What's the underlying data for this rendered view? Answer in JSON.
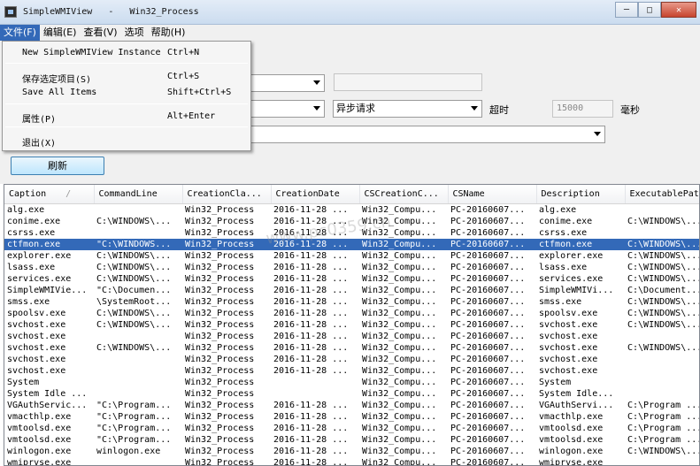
{
  "window": {
    "title": "SimpleWMIView   -   Win32_Process",
    "controls": [
      "─",
      "□",
      "✕"
    ]
  },
  "menubar": [
    {
      "label": "文件(F)",
      "active": true
    },
    {
      "label": "编辑(E)",
      "active": false
    },
    {
      "label": "查看(V)",
      "active": false
    },
    {
      "label": "选项",
      "active": false
    },
    {
      "label": "帮助(H)",
      "active": false
    }
  ],
  "file_menu": [
    {
      "label": "New SimpleWMIView Instance",
      "shortcut": "Ctrl+N"
    },
    {
      "label": "保存选定项目(S)",
      "shortcut": "Ctrl+S"
    },
    {
      "label": "Save All Items",
      "shortcut": "Shift+Ctrl+S"
    },
    {
      "label": "属性(P)",
      "shortcut": "Alt+Enter"
    },
    {
      "label": "退出(X)",
      "shortcut": ""
    }
  ],
  "form": {
    "request_mode": "异步请求",
    "timeout_label": "超时",
    "timeout_value": "15000",
    "timeout_unit": "毫秒",
    "refresh_button": "刷新"
  },
  "table": {
    "columns": [
      "Caption",
      "CommandLine",
      "CreationCla...",
      "CreationDate",
      "CSCreationC...",
      "CSName",
      "Description",
      "ExecutablePat"
    ],
    "selected_row": 3,
    "rows": [
      [
        "alg.exe",
        "",
        "Win32_Process",
        "2016-11-28 ...",
        "Win32_Compu...",
        "PC-20160607...",
        "alg.exe",
        ""
      ],
      [
        "conime.exe",
        "C:\\WINDOWS\\...",
        "Win32_Process",
        "2016-11-28 ...",
        "Win32_Compu...",
        "PC-20160607...",
        "conime.exe",
        "C:\\WINDOWS\\..."
      ],
      [
        "csrss.exe",
        "",
        "Win32_Process",
        "2016-11-28 ...",
        "Win32_Compu...",
        "PC-20160607...",
        "csrss.exe",
        ""
      ],
      [
        "ctfmon.exe",
        "\"C:\\WINDOWS...",
        "Win32_Process",
        "2016-11-28 ...",
        "Win32_Compu...",
        "PC-20160607...",
        "ctfmon.exe",
        "C:\\WINDOWS\\..."
      ],
      [
        "explorer.exe",
        "C:\\WINDOWS\\...",
        "Win32_Process",
        "2016-11-28 ...",
        "Win32_Compu...",
        "PC-20160607...",
        "explorer.exe",
        "C:\\WINDOWS\\..."
      ],
      [
        "lsass.exe",
        "C:\\WINDOWS\\...",
        "Win32_Process",
        "2016-11-28 ...",
        "Win32_Compu...",
        "PC-20160607...",
        "lsass.exe",
        "C:\\WINDOWS\\..."
      ],
      [
        "services.exe",
        "C:\\WINDOWS\\...",
        "Win32_Process",
        "2016-11-28 ...",
        "Win32_Compu...",
        "PC-20160607...",
        "services.exe",
        "C:\\WINDOWS\\..."
      ],
      [
        "SimpleWMIVie...",
        "\"C:\\Documen...",
        "Win32_Process",
        "2016-11-28 ...",
        "Win32_Compu...",
        "PC-20160607...",
        "SimpleWMIVi...",
        "C:\\Document..."
      ],
      [
        "smss.exe",
        "\\SystemRoot...",
        "Win32_Process",
        "2016-11-28 ...",
        "Win32_Compu...",
        "PC-20160607...",
        "smss.exe",
        "C:\\WINDOWS\\..."
      ],
      [
        "spoolsv.exe",
        "C:\\WINDOWS\\...",
        "Win32_Process",
        "2016-11-28 ...",
        "Win32_Compu...",
        "PC-20160607...",
        "spoolsv.exe",
        "C:\\WINDOWS\\..."
      ],
      [
        "svchost.exe",
        "C:\\WINDOWS\\...",
        "Win32_Process",
        "2016-11-28 ...",
        "Win32_Compu...",
        "PC-20160607...",
        "svchost.exe",
        "C:\\WINDOWS\\..."
      ],
      [
        "svchost.exe",
        "",
        "Win32_Process",
        "2016-11-28 ...",
        "Win32_Compu...",
        "PC-20160607...",
        "svchost.exe",
        ""
      ],
      [
        "svchost.exe",
        "C:\\WINDOWS\\...",
        "Win32_Process",
        "2016-11-28 ...",
        "Win32_Compu...",
        "PC-20160607...",
        "svchost.exe",
        "C:\\WINDOWS\\..."
      ],
      [
        "svchost.exe",
        "",
        "Win32_Process",
        "2016-11-28 ...",
        "Win32_Compu...",
        "PC-20160607...",
        "svchost.exe",
        ""
      ],
      [
        "svchost.exe",
        "",
        "Win32_Process",
        "2016-11-28 ...",
        "Win32_Compu...",
        "PC-20160607...",
        "svchost.exe",
        ""
      ],
      [
        "System",
        "",
        "Win32_Process",
        "",
        "Win32_Compu...",
        "PC-20160607...",
        "System",
        ""
      ],
      [
        "System Idle ...",
        "",
        "Win32_Process",
        "",
        "Win32_Compu...",
        "PC-20160607...",
        "System Idle...",
        ""
      ],
      [
        "VGAuthServic...",
        "\"C:\\Program...",
        "Win32_Process",
        "2016-11-28 ...",
        "Win32_Compu...",
        "PC-20160607...",
        "VGAuthServi...",
        "C:\\Program ..."
      ],
      [
        "vmacthlp.exe",
        "\"C:\\Program...",
        "Win32_Process",
        "2016-11-28 ...",
        "Win32_Compu...",
        "PC-20160607...",
        "vmacthlp.exe",
        "C:\\Program ..."
      ],
      [
        "vmtoolsd.exe",
        "\"C:\\Program...",
        "Win32_Process",
        "2016-11-28 ...",
        "Win32_Compu...",
        "PC-20160607...",
        "vmtoolsd.exe",
        "C:\\Program ..."
      ],
      [
        "vmtoolsd.exe",
        "\"C:\\Program...",
        "Win32_Process",
        "2016-11-28 ...",
        "Win32_Compu...",
        "PC-20160607...",
        "vmtoolsd.exe",
        "C:\\Program ..."
      ],
      [
        "winlogon.exe",
        "winlogon.exe",
        "Win32_Process",
        "2016-11-28 ...",
        "Win32_Compu...",
        "PC-20160607...",
        "winlogon.exe",
        "C:\\WINDOWS\\..."
      ],
      [
        "wmiprvse.exe",
        "",
        "Win32_Process",
        "2016-11-28 ...",
        "Win32_Compu...",
        "PC-20160607...",
        "wmiprvse.exe",
        ""
      ]
    ]
  },
  "watermark": "www.pc0359.cn"
}
